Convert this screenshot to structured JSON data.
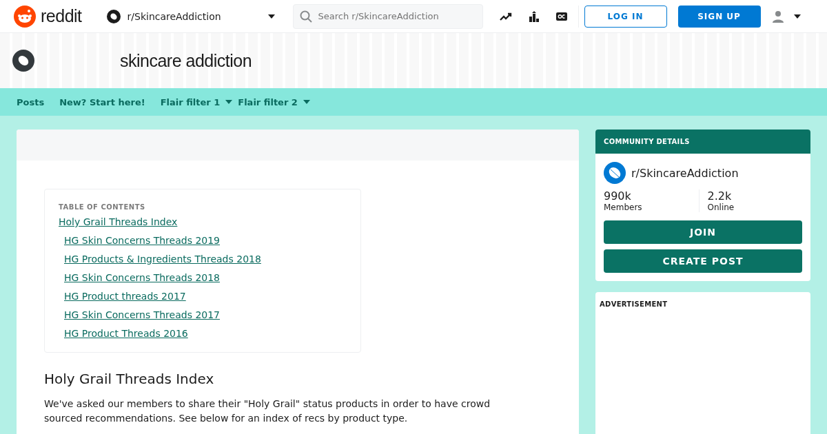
{
  "header": {
    "logo_text": "reddit",
    "community": "r/SkincareAddiction",
    "search": {
      "placeholder": "Search r/SkincareAddiction"
    },
    "buttons": [
      "LOG IN",
      "SIGN UP"
    ]
  },
  "banner": {
    "title": "skincare addiction"
  },
  "nav": [
    {
      "label": "Posts",
      "dropdown": false
    },
    {
      "label": "New? Start here!",
      "dropdown": false
    },
    {
      "label": "Flair filter 1",
      "dropdown": true
    },
    {
      "label": "Flair filter 2",
      "dropdown": true
    }
  ],
  "toc": {
    "heading": "TABLE OF CONTENTS",
    "items": [
      {
        "label": "Holy Grail Threads Index",
        "children": [
          {
            "label": "HG Skin Concerns Threads 2019"
          },
          {
            "label": "HG Products & Ingredients Threads 2018"
          },
          {
            "label": "HG Skin Concerns Threads 2018"
          },
          {
            "label": "HG Product threads 2017"
          },
          {
            "label": "HG Skin Concerns Threads 2017"
          },
          {
            "label": "HG Product Threads 2016"
          }
        ]
      }
    ]
  },
  "article": {
    "heading": "Holy Grail Threads Index",
    "paragraph": "We've asked our members to share their \"Holy Grail\" status products in order to have crowd sourced recommendations. See below for an index of recs by product type."
  },
  "community_details": {
    "heading": "COMMUNITY DETAILS",
    "name": "r/SkincareAddiction",
    "stats": [
      {
        "value": "990k",
        "label": "Members"
      },
      {
        "value": "2.2k",
        "label": "Online"
      }
    ],
    "buttons": [
      "JOIN",
      "CREATE POST"
    ]
  },
  "advertisement": {
    "label": "ADVERTISEMENT"
  }
}
